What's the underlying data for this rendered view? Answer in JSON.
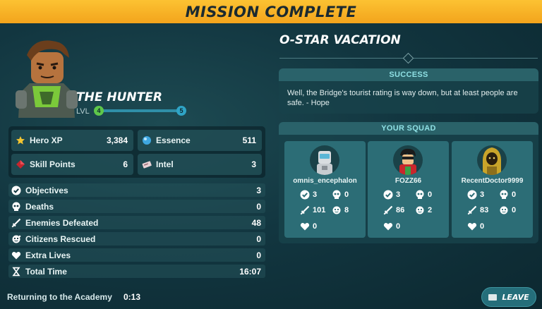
{
  "banner": {
    "title": "MISSION COMPLETE"
  },
  "hero": {
    "name": "THE HUNTER",
    "level_label": "LVL",
    "level_current": "4",
    "level_next": "5",
    "level_progress": 1.0
  },
  "rewards": {
    "hero_xp": {
      "label": "Hero XP",
      "value": "3,384"
    },
    "essence": {
      "label": "Essence",
      "value": "511"
    },
    "skill_points": {
      "label": "Skill Points",
      "value": "6"
    },
    "intel": {
      "label": "Intel",
      "value": "3"
    }
  },
  "summary": [
    {
      "label": "Objectives",
      "value": "3",
      "icon": "check-icon"
    },
    {
      "label": "Deaths",
      "value": "0",
      "icon": "skull-icon"
    },
    {
      "label": "Enemies Defeated",
      "value": "48",
      "icon": "sword-icon"
    },
    {
      "label": "Citizens Rescued",
      "value": "0",
      "icon": "citizen-icon"
    },
    {
      "label": "Extra Lives",
      "value": "0",
      "icon": "heart-icon"
    },
    {
      "label": "Total Time",
      "value": "16:07",
      "icon": "hourglass-icon"
    }
  ],
  "footer": {
    "return_label": "Returning to the Academy",
    "return_time": "0:13",
    "leave_label": "LEAVE"
  },
  "mission": {
    "name": "O-STAR VACATION",
    "result_header": "SUCCESS",
    "quote": "Well, the Bridge's tourist rating is way down, but at least people are safe. - Hope"
  },
  "squad": {
    "header": "YOUR SQUAD",
    "members": [
      {
        "name": "omnis_encephalon",
        "objectives": "3",
        "deaths": "0",
        "enemies": "101",
        "citizens": "8",
        "lives": "0"
      },
      {
        "name": "FOZZ66",
        "objectives": "3",
        "deaths": "0",
        "enemies": "86",
        "citizens": "2",
        "lives": "0"
      },
      {
        "name": "RecentDoctor9999",
        "objectives": "3",
        "deaths": "0",
        "enemies": "83",
        "citizens": "0",
        "lives": "0"
      }
    ]
  },
  "colors": {
    "banner": "#f3a41c",
    "accent_teal": "#8fe0e4",
    "level_green": "#5ec74a",
    "level_blue": "#2fa4c6"
  }
}
